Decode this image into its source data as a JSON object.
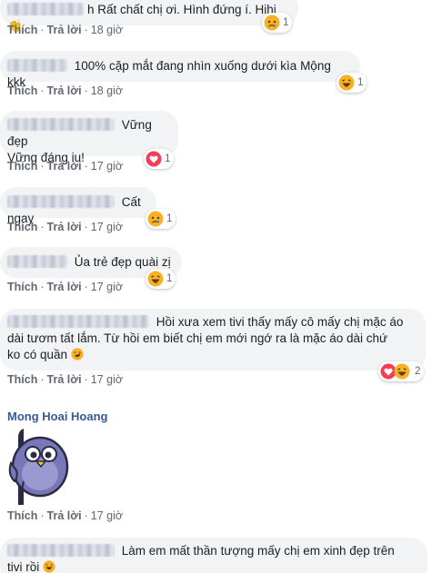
{
  "actions": {
    "like": "Thích",
    "reply": "Trả lời",
    "separator": "·"
  },
  "comments": [
    {
      "name_tail": "h",
      "text": "Rất chất chị ơi. Hình đứng í. Hihi",
      "emoji_inline": "👏",
      "reaction": "sad-emoji",
      "reaction_count": "1",
      "time": "18 giờ"
    },
    {
      "text": "100% cặp mắt đang nhìn xuống dưới kìa Mộng kkk",
      "reaction": "haha-emoji",
      "reaction_count": "1",
      "time": "18 giờ"
    },
    {
      "text_line1": "Vững đẹp",
      "text_line2": "Vững đáng iu!",
      "reaction": "love-emoji",
      "reaction_count": "1",
      "time": "17 giờ"
    },
    {
      "text": "Cất ngay",
      "reaction": "sad-emoji",
      "reaction_count": "1",
      "time": "17 giờ"
    },
    {
      "text": "Ủa trẻ đẹp quài zị",
      "reaction": "haha-emoji",
      "reaction_count": "1",
      "time": "17 giờ"
    },
    {
      "text_line1": "Hồi xưa xem tivi thấy mấy cô mấy chị mặc áo",
      "text_line2": "dài tươm tất lắm. Từ hồi em biết chị em mới ngớ ra là mặc áo dài chứ",
      "text_line3": "ko có quần",
      "reaction": "love-haha-emoji",
      "reaction_count": "2",
      "time": "17 giờ"
    },
    {
      "author": "Mong Hoai Hoang",
      "sticker": "peeking-bird-sticker",
      "time": "17 giờ"
    },
    {
      "text_line1": "Làm em mất thần tượng mấy chị em xinh đẹp trên",
      "text_line2": "tivi rồi"
    }
  ],
  "colors": {
    "bubble": "#f2f3f5",
    "author": "#385898",
    "meta": "#606770",
    "love": "#f33e58",
    "haha": "#f7b125"
  }
}
